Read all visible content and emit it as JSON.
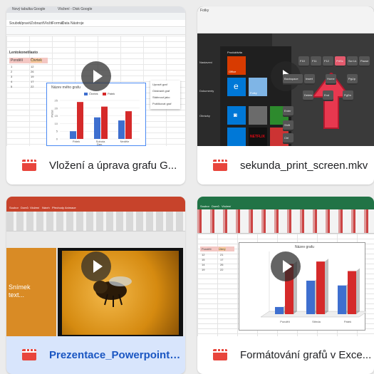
{
  "videos": [
    {
      "title": "Vložení a úprava grafu G...",
      "thumb": {
        "browser_tab_1": "Nový tabulka Google",
        "browser_tab_2": "Vložení - Disk Google",
        "menu": [
          "Soubor",
          "Upravit",
          "Zobrazit",
          "Vložit",
          "Formát",
          "Data",
          "Nástroje",
          "Doplňky",
          "Nápověda"
        ],
        "table_title": "Lentokonetilasto",
        "table_headers": [
          "Pondělí",
          "Čtvrtek"
        ],
        "table_rows": [
          [
            "1",
            "12"
          ],
          [
            "2",
            "26"
          ],
          [
            "3",
            "19"
          ],
          [
            "4",
            "17"
          ],
          [
            "5",
            "22"
          ]
        ],
        "chart_title": "Název mého grafu",
        "legend": [
          "Čtvrtek",
          "Pátek"
        ],
        "axis_title": "Den",
        "y_axis_title": "Počet",
        "y_ticks": [
          "0",
          "5",
          "10",
          "15",
          "20",
          "25"
        ],
        "categories": [
          "Pátek",
          "Sobota",
          "Neděle"
        ],
        "menu_options": [
          "Upravit graf",
          "Odstranit graf",
          "Stáhnout jako",
          "Publikovat graf"
        ]
      }
    },
    {
      "title": "sekunda_print_screen.mkv",
      "thumb": {
        "window_label": "Fotky",
        "keys_row1": [
          "F10",
          "F11",
          "F12",
          "PrtSc",
          "Scr Lk",
          "Pause"
        ],
        "keys_row2": [
          "Backspace",
          "Insert",
          "Home",
          "PgUp"
        ],
        "keys_row3": [
          "Delete",
          "End",
          "PgDn"
        ],
        "keys_row4": [
          "Enter"
        ],
        "keys_row5": [
          "Shift"
        ],
        "keys_row6": [
          "Ctrl"
        ],
        "start_header": "Produktivita",
        "tiles": [
          "Office",
          "Microsoft Edge",
          "Fotky",
          "Microsoft Store",
          "NETFLIX",
          "Hry"
        ],
        "sidebar_items": [
          "Nastavení",
          "Dokumenty",
          "Obrázky"
        ]
      }
    },
    {
      "title": "Prezentace_Powerpoint_...",
      "selected": true,
      "thumb": {
        "menu": [
          "Soubor",
          "Domů",
          "Vložení",
          "Návrh",
          "Přechody",
          "Animace",
          "Prezentace",
          "Revize",
          "Zobrazení",
          "Nápověda",
          "Formát"
        ],
        "slide_text": "Snímek\ntext..."
      }
    },
    {
      "title": "Formátování grafů v Exce...",
      "thumb": {
        "menu": [
          "Soubor",
          "Domů",
          "Vložení",
          "Rozložení stránky",
          "Vzorce",
          "Data",
          "Revize",
          "Zobrazení",
          "Návrh",
          "Formát"
        ],
        "table_headers": [
          "Pondělí",
          "Úterý"
        ],
        "table_rows": [
          [
            "12",
            "21"
          ],
          [
            "15",
            "17"
          ],
          [
            "14",
            "26"
          ],
          [
            "19",
            "22"
          ]
        ],
        "chart_title": "Název grafu",
        "categories": [
          "Pondělí",
          "Středa",
          "Pátek"
        ]
      }
    }
  ],
  "colors": {
    "bar_red": "#d52a2a",
    "bar_blue": "#3e6fcf",
    "ppt_orange": "#d98b25",
    "excel_green": "#217346",
    "ppt_red": "#c7432b"
  }
}
